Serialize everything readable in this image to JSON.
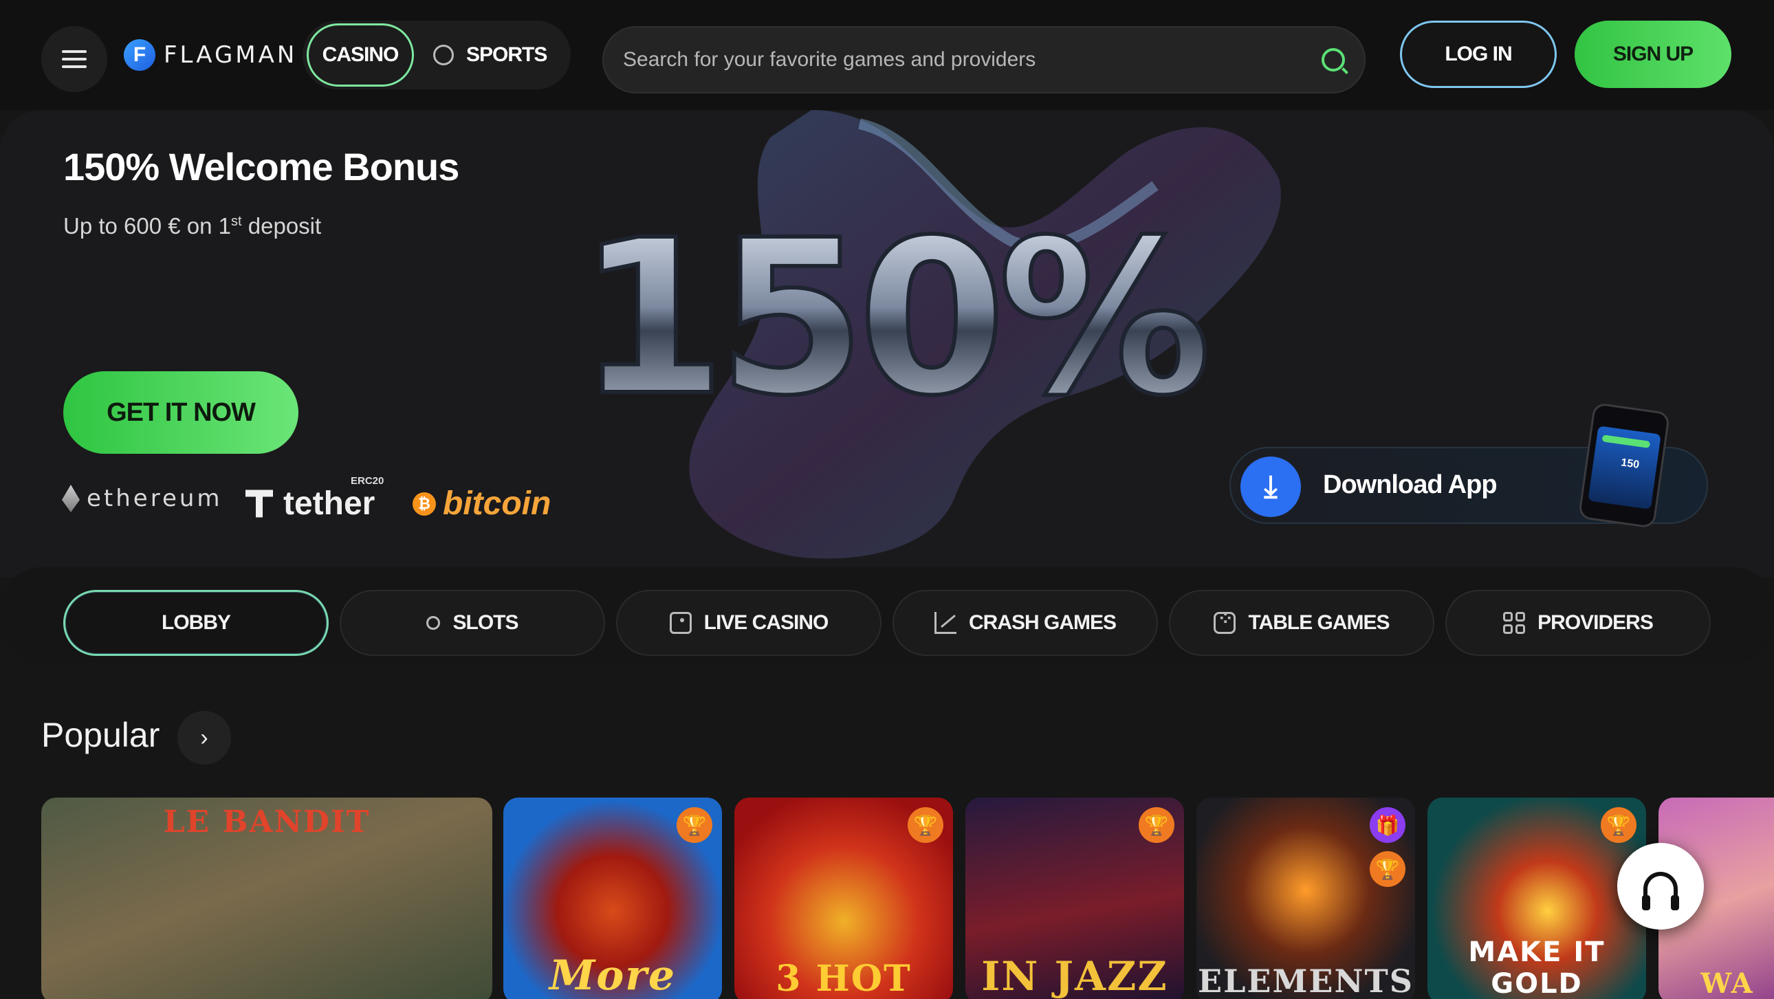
{
  "header": {
    "brand": "FLAGMAN",
    "brand_mark": "F",
    "tabs": [
      {
        "label": "CASINO",
        "active": true
      },
      {
        "label": "SPORTS",
        "active": false,
        "icon": "soccer-ball-icon"
      }
    ],
    "search": {
      "placeholder": "Search for your favorite games and providers",
      "icon": "search-icon"
    },
    "login_label": "LOG IN",
    "signup_label": "SIGN UP"
  },
  "hero": {
    "title": "150% Welcome Bonus",
    "subtitle_prefix": "Up to 600 € on 1",
    "subtitle_sup": "st",
    "subtitle_suffix": " deposit",
    "big_text": "150%",
    "cta_label": "GET IT NOW",
    "payments": {
      "ethereum": "ethereum",
      "tether": "tether",
      "tether_tag": "ERC20",
      "bitcoin": "bitcoin",
      "bitcoin_mark": "₿"
    },
    "download": {
      "label": "Download App",
      "icon": "download-icon",
      "phone_text": "150"
    }
  },
  "categories": [
    {
      "label": "LOBBY",
      "active": true,
      "icon": ""
    },
    {
      "label": "SLOTS",
      "active": false,
      "icon": "cherries-icon"
    },
    {
      "label": "LIVE CASINO",
      "active": false,
      "icon": "live-icon"
    },
    {
      "label": "CRASH GAMES",
      "active": false,
      "icon": "chart-up-icon"
    },
    {
      "label": "TABLE GAMES",
      "active": false,
      "icon": "dice-icon"
    },
    {
      "label": "PROVIDERS",
      "active": false,
      "icon": "grid-icon"
    }
  ],
  "popular": {
    "title": "Popular",
    "games": [
      {
        "title": "LE BANDIT",
        "badges": []
      },
      {
        "title": "More",
        "badges": [
          "trophy"
        ]
      },
      {
        "title": "3 HOT",
        "badges": [
          "trophy"
        ]
      },
      {
        "title": "IN JAZZ",
        "badges": [
          "trophy"
        ]
      },
      {
        "title": "ELEMENTS",
        "badges": [
          "gift",
          "trophy"
        ]
      },
      {
        "title": "MAKE IT GOLD",
        "badges": [
          "trophy"
        ]
      },
      {
        "title": "WA",
        "badges": []
      }
    ]
  },
  "colors": {
    "accent_green": "#4fd85f",
    "login_border": "#7ec7f0",
    "download_blue": "#2b6ff3",
    "trophy_orange": "#f07a21",
    "gift_purple": "#8b3df0"
  }
}
